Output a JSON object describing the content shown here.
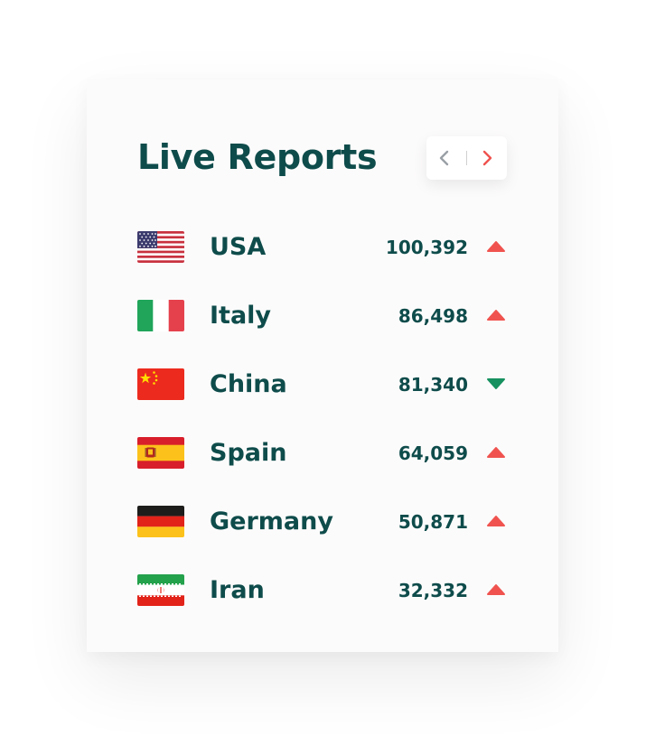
{
  "widget": {
    "title": "Live Reports",
    "nav": {
      "prev_icon": "chevron-left-icon",
      "next_icon": "chevron-right-icon"
    }
  },
  "colors": {
    "title": "#0e4c4b",
    "up": "#f0534f",
    "down": "#16915f",
    "nav_prev": "#9aa0a6",
    "nav_next": "#f0534f"
  },
  "reports": [
    {
      "country": "USA",
      "value": "100,392",
      "trend": "up",
      "flag": "usa-flag-icon"
    },
    {
      "country": "Italy",
      "value": "86,498",
      "trend": "up",
      "flag": "italy-flag-icon"
    },
    {
      "country": "China",
      "value": "81,340",
      "trend": "down",
      "flag": "china-flag-icon"
    },
    {
      "country": "Spain",
      "value": "64,059",
      "trend": "up",
      "flag": "spain-flag-icon"
    },
    {
      "country": "Germany",
      "value": "50,871",
      "trend": "up",
      "flag": "germany-flag-icon"
    },
    {
      "country": "Iran",
      "value": "32,332",
      "trend": "up",
      "flag": "iran-flag-icon"
    }
  ]
}
